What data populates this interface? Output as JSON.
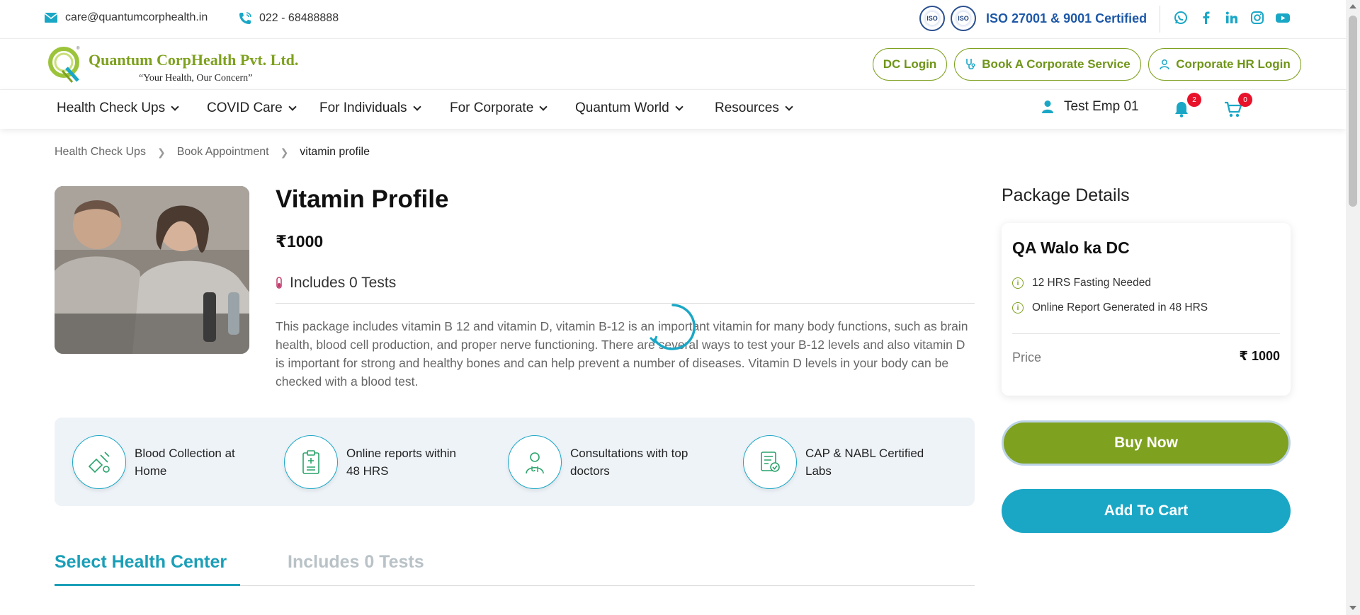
{
  "topbar": {
    "email": "care@quantumcorphealth.in",
    "phone": "022 - 68488888",
    "iso_text": "ISO 27001 & 9001 Certified",
    "iso_badge_label": "ISO",
    "social": [
      "whatsapp-icon",
      "facebook-icon",
      "linkedin-icon",
      "instagram-icon",
      "youtube-icon"
    ]
  },
  "brand": {
    "name": "Quantum CorpHealth Pvt. Ltd.",
    "tagline": "“Your Health, Our Concern”"
  },
  "header_buttons": {
    "dc_login": "DC Login",
    "book_service": "Book A Corporate Service",
    "hr_login": "Corporate HR Login"
  },
  "nav": {
    "items": [
      "Health Check Ups",
      "COVID Care",
      "For Individuals",
      "For Corporate",
      "Quantum World",
      "Resources"
    ],
    "user_name": "Test Emp 01",
    "notifications_count": "2",
    "cart_count": "0"
  },
  "breadcrumb": [
    "Health Check Ups",
    "Book Appointment",
    "vitamin profile"
  ],
  "package": {
    "title": "Vitamin Profile",
    "price": "₹1000",
    "includes": "Includes 0 Tests",
    "description": "This package includes vitamin B 12 and vitamin D, vitamin B-12 is an important vitamin for many body functions, such as brain health, blood cell production, and proper nerve functioning. There are several ways to test your B-12 levels and also vitamin D is important for strong and healthy bones and can help prevent a number of diseases. Vitamin D levels in your body can be checked with a blood test."
  },
  "features": [
    {
      "label": "Blood Collection at Home",
      "icon": "blood-collection-icon"
    },
    {
      "label": "Online reports within 48 HRS",
      "icon": "report-clipboard-icon"
    },
    {
      "label": "Consultations with top doctors",
      "icon": "doctor-icon"
    },
    {
      "label": "CAP & NABL Certified Labs",
      "icon": "certificate-icon"
    }
  ],
  "tabs": {
    "active": "Select Health Center",
    "inactive": "Includes 0 Tests"
  },
  "details": {
    "heading": "Package Details",
    "center_name": "QA Walo ka DC",
    "info": [
      "12 HRS Fasting Needed",
      "Online Report Generated in 48 HRS"
    ],
    "price_label": "Price",
    "price_value": "₹ 1000"
  },
  "actions": {
    "buy_now": "Buy Now",
    "add_to_cart": "Add To Cart"
  },
  "colors": {
    "brand_green": "#7ea11f",
    "brand_teal": "#1aa7c6",
    "badge_red": "#e8132b",
    "iso_blue": "#1f59a8"
  }
}
